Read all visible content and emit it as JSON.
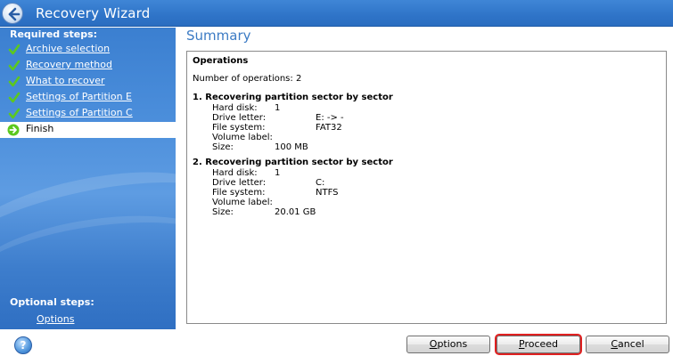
{
  "window": {
    "title": "Recovery Wizard"
  },
  "sidebar": {
    "required_heading": "Required steps:",
    "steps": [
      {
        "label": "Archive selection",
        "state": "done"
      },
      {
        "label": "Recovery method",
        "state": "done"
      },
      {
        "label": "What to recover",
        "state": "done"
      },
      {
        "label": "Settings of Partition E",
        "state": "done"
      },
      {
        "label": "Settings of Partition C",
        "state": "done"
      },
      {
        "label": "Finish",
        "state": "current"
      }
    ],
    "optional_heading": "Optional steps:",
    "optional_link": "Options"
  },
  "main": {
    "title": "Summary",
    "section_heading": "Operations",
    "count_text": "Number of operations: 2",
    "operations": [
      {
        "heading": "1. Recovering partition sector by sector",
        "fields": [
          {
            "label": "Hard disk:",
            "value": "1"
          },
          {
            "label": "Drive letter:",
            "value": "E: -> -"
          },
          {
            "label": "File system:",
            "value": "FAT32"
          },
          {
            "label": "Volume label:",
            "value": ""
          },
          {
            "label": "Size:",
            "value": "100 MB"
          }
        ]
      },
      {
        "heading": "2. Recovering partition sector by sector",
        "fields": [
          {
            "label": "Hard disk:",
            "value": "1"
          },
          {
            "label": "Drive letter:",
            "value": "C:"
          },
          {
            "label": "File system:",
            "value": "NTFS"
          },
          {
            "label": "Volume label:",
            "value": ""
          },
          {
            "label": "Size:",
            "value": "20.01 GB"
          }
        ]
      }
    ]
  },
  "footer": {
    "options_label": {
      "mnemonic": "O",
      "rest": "ptions"
    },
    "proceed_label": {
      "mnemonic": "P",
      "rest": "roceed"
    },
    "cancel_label": {
      "mnemonic": "C",
      "rest": "ancel"
    },
    "help_glyph": "?"
  },
  "colors": {
    "accent": "#3c7bc4",
    "sidebar": "#3b7fd0",
    "highlight": "#e02020",
    "check": "#5cc81e"
  }
}
